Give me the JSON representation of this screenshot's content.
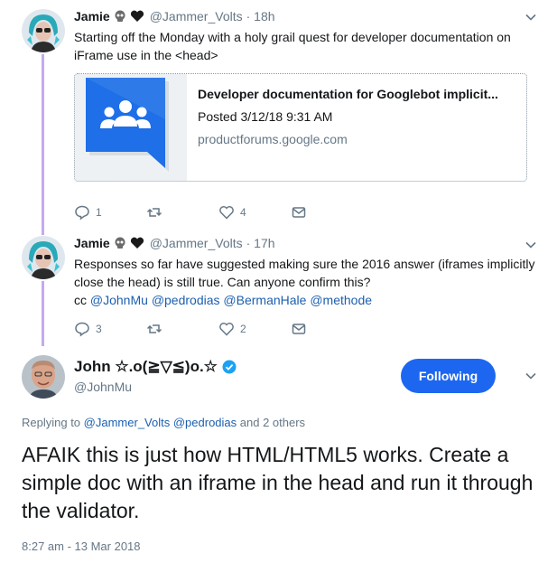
{
  "tweet1": {
    "name": "Jamie",
    "handle": "@Jammer_Volts",
    "time": "· 18h",
    "text": "Starting off the Monday with a holy grail quest for developer documentation on iFrame use in the <head>",
    "card": {
      "title": "Developer documentation for Googlebot implicit...",
      "date": "Posted 3/12/18 9:31 AM",
      "domain": "productforums.google.com"
    },
    "replies": "1",
    "retweets": "",
    "likes": "4"
  },
  "tweet2": {
    "name": "Jamie",
    "handle": "@Jammer_Volts",
    "time": "· 17h",
    "text": "Responses so far have suggested making sure the 2016 answer (iframes implicitly close the head) is still true.  Can anyone confirm this?",
    "cc_prefix": "cc",
    "mentions": [
      "@JohnMu",
      "@pedrodias",
      "@BermanHale",
      "@methode"
    ],
    "replies": "3",
    "retweets": "",
    "likes": "2"
  },
  "main": {
    "name": "John ☆.o(≧▽≦)o.☆",
    "handle": "@JohnMu",
    "follow_label": "Following",
    "replying_prefix": "Replying to",
    "replying_users": [
      "@Jammer_Volts",
      "@pedrodias"
    ],
    "replying_suffix": "and 2 others",
    "text": "AFAIK this is just how HTML/HTML5 works. Create a simple doc with an iframe in the head and run it through the validator.",
    "timestamp": "8:27 am - 13 Mar 2018"
  },
  "colors": {
    "accent": "#1d67f0",
    "link": "#1b5fb0",
    "muted": "#657786",
    "thread": "#c5a8f0"
  }
}
